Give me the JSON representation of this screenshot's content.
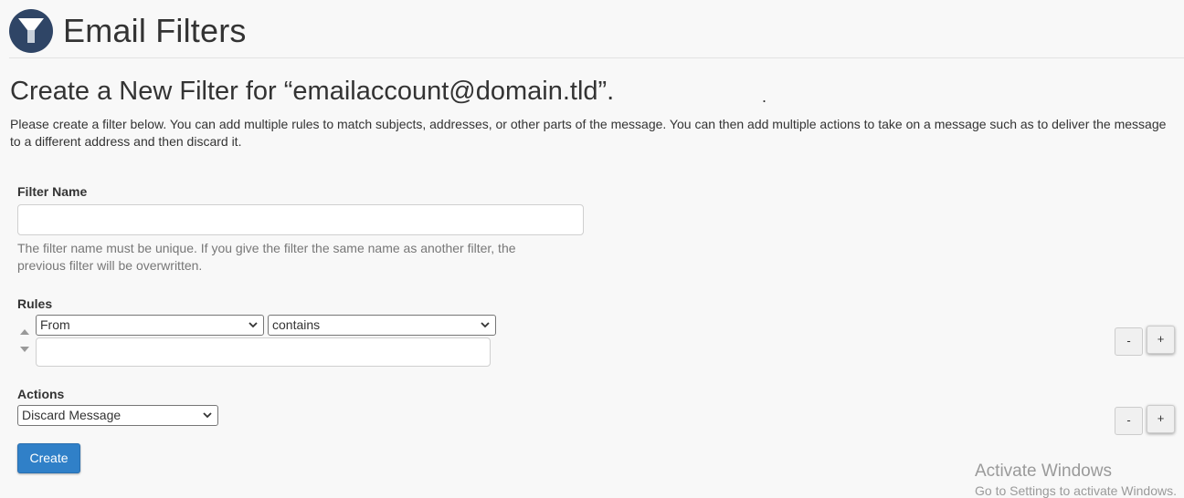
{
  "header": {
    "title": "Email Filters",
    "icon": "funnel-icon"
  },
  "page": {
    "subtitle": "Create a New Filter for “emailaccount@domain.tld”.",
    "stray_mark": ".",
    "description": "Please create a filter below. You can add multiple rules to match subjects, addresses, or other parts of the message. You can then add multiple actions to take on a message such as to deliver the message to a different address and then discard it."
  },
  "filter_name": {
    "label": "Filter Name",
    "value": "",
    "help": "The filter name must be unique. If you give the filter the same name as another filter, the previous filter will be overwritten."
  },
  "rules": {
    "label": "Rules",
    "part_selected": "From",
    "match_selected": "contains",
    "value": "",
    "remove_label": "-",
    "add_label": "+"
  },
  "actions": {
    "label": "Actions",
    "action_selected": "Discard Message",
    "remove_label": "-",
    "add_label": "+"
  },
  "create_button": {
    "label": "Create"
  },
  "watermark": {
    "title": "Activate Windows",
    "subtitle": "Go to Settings to activate Windows."
  },
  "colors": {
    "brand": "#2f4566",
    "primary_button": "#3080c8",
    "background": "#f8f8f8"
  }
}
